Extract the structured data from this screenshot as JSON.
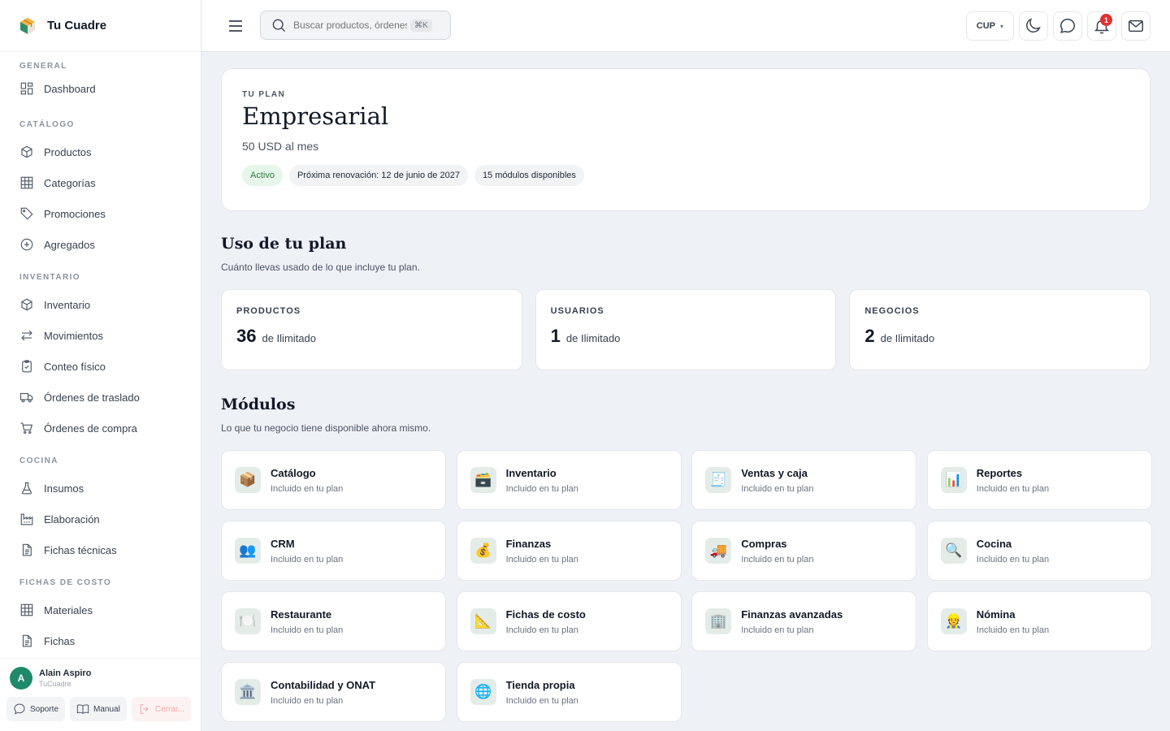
{
  "brand": {
    "name": "Tu Cuadre"
  },
  "sidebar": {
    "sections": [
      {
        "label": "GENERAL",
        "items": [
          {
            "label": "Dashboard",
            "icon": "dashboard-icon"
          }
        ]
      },
      {
        "label": "CATÁLOGO",
        "items": [
          {
            "label": "Productos",
            "icon": "box-icon"
          },
          {
            "label": "Categorías",
            "icon": "grid-icon"
          },
          {
            "label": "Promociones",
            "icon": "tag-icon"
          },
          {
            "label": "Agregados",
            "icon": "plus-circle-icon"
          }
        ]
      },
      {
        "label": "INVENTARIO",
        "items": [
          {
            "label": "Inventario",
            "icon": "box-icon"
          },
          {
            "label": "Movimientos",
            "icon": "arrows-icon"
          },
          {
            "label": "Conteo físico",
            "icon": "clipboard-icon"
          },
          {
            "label": "Órdenes de traslado",
            "icon": "truck-icon"
          },
          {
            "label": "Órdenes de compra",
            "icon": "cart-icon"
          }
        ]
      },
      {
        "label": "COCINA",
        "items": [
          {
            "label": "Insumos",
            "icon": "flask-icon"
          },
          {
            "label": "Elaboración",
            "icon": "factory-icon"
          },
          {
            "label": "Fichas técnicas",
            "icon": "document-icon"
          }
        ]
      },
      {
        "label": "FICHAS DE COSTO",
        "items": [
          {
            "label": "Materiales",
            "icon": "grid-icon"
          },
          {
            "label": "Fichas",
            "icon": "document-icon"
          }
        ]
      }
    ]
  },
  "user": {
    "initial": "A",
    "name": "Alain Aspiro",
    "org": "TuCuadre",
    "actions": {
      "support": "Soporte",
      "manual": "Manual",
      "logout": "Cerrar..."
    }
  },
  "topbar": {
    "search_placeholder": "Buscar productos, órdenes",
    "search_shortcut": "⌘K",
    "currency": "CUP",
    "notifications_count": "1"
  },
  "plan": {
    "eyebrow": "TU PLAN",
    "name": "Empresarial",
    "price": "50 USD al mes",
    "status": "Activo",
    "renewal": "Próxima renovación: 12 de junio de 2027",
    "modules_available": "15 módulos disponibles"
  },
  "usage": {
    "title": "Uso de tu plan",
    "subtitle": "Cuánto llevas usado de lo que incluye tu plan.",
    "cards": [
      {
        "label": "PRODUCTOS",
        "value": "36",
        "limit": "de Ilimitado"
      },
      {
        "label": "USUARIOS",
        "value": "1",
        "limit": "de Ilimitado"
      },
      {
        "label": "NEGOCIOS",
        "value": "2",
        "limit": "de Ilimitado"
      }
    ]
  },
  "modules": {
    "title": "Módulos",
    "subtitle": "Lo que tu negocio tiene disponible ahora mismo.",
    "items": [
      {
        "name": "Catálogo",
        "sub": "Incluido en tu plan",
        "emoji": "📦",
        "icon": "package-icon"
      },
      {
        "name": "Inventario",
        "sub": "Incluido en tu plan",
        "emoji": "🗃️",
        "icon": "inventory-icon"
      },
      {
        "name": "Ventas y caja",
        "sub": "Incluido en tu plan",
        "emoji": "🧾",
        "icon": "receipt-icon"
      },
      {
        "name": "Reportes",
        "sub": "Incluido en tu plan",
        "emoji": "📊",
        "icon": "bar-chart-icon"
      },
      {
        "name": "CRM",
        "sub": "Incluido en tu plan",
        "emoji": "👥",
        "icon": "people-icon"
      },
      {
        "name": "Finanzas",
        "sub": "Incluido en tu plan",
        "emoji": "💰",
        "icon": "money-bag-icon"
      },
      {
        "name": "Compras",
        "sub": "Incluido en tu plan",
        "emoji": "🚚",
        "icon": "delivery-truck-icon"
      },
      {
        "name": "Cocina",
        "sub": "Incluido en tu plan",
        "emoji": "🔍",
        "icon": "magnifier-icon"
      },
      {
        "name": "Restaurante",
        "sub": "Incluido en tu plan",
        "emoji": "🍽️",
        "icon": "plate-icon"
      },
      {
        "name": "Fichas de costo",
        "sub": "Incluido en tu plan",
        "emoji": "📐",
        "icon": "ruler-icon"
      },
      {
        "name": "Finanzas avanzadas",
        "sub": "Incluido en tu plan",
        "emoji": "🏢",
        "icon": "building-icon"
      },
      {
        "name": "Nómina",
        "sub": "Incluido en tu plan",
        "emoji": "👷",
        "icon": "worker-icon"
      },
      {
        "name": "Contabilidad y ONAT",
        "sub": "Incluido en tu plan",
        "emoji": "🏛️",
        "icon": "bank-icon"
      },
      {
        "name": "Tienda propia",
        "sub": "Incluido en tu plan",
        "emoji": "🌐",
        "icon": "globe-icon"
      }
    ]
  }
}
